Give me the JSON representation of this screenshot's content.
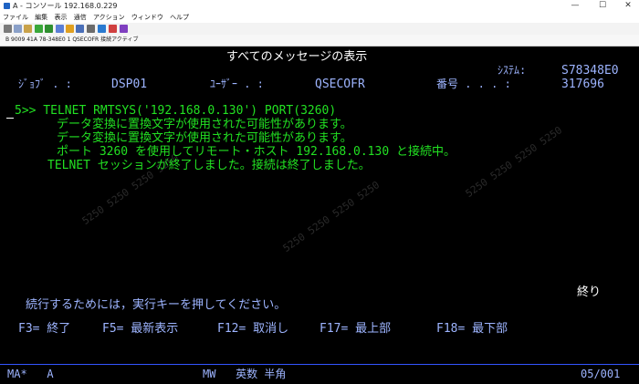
{
  "window": {
    "title": "A - コンソール 192.168.0.229",
    "minimize": "—",
    "maximize": "☐",
    "close": "✕"
  },
  "menu": [
    "ファイル",
    "編集",
    "表示",
    "通信",
    "アクション",
    "ウィンドウ",
    "ヘルプ"
  ],
  "session_bar": "B 9009 41A  78-348E0  1 QSECOFR    接続アクティブ",
  "screen": {
    "title": "すべてのメッセージの表示",
    "system_label": "ｼｽﾃﾑ:",
    "system_value": "S78348E0",
    "job_label": "ｼﾞｮﾌﾞ . :",
    "job_value": "DSP01",
    "user_label": "ﾕｰｻﾞｰ . :",
    "user_value": "QSECOFR",
    "number_label": "番号 . . . :",
    "number_value": "317696",
    "command": "5>> TELNET RMTSYS('192.168.0.130') PORT(3260)",
    "messages": [
      "データ変換に置換文字が使用された可能性があります。",
      "データ変換に置換文字が使用された可能性があります。",
      "ポート 3260 を使用してリモート・ホスト 192.168.0.130 と接続中。"
    ],
    "session_end": "TELNET セッションが終了しました。接続は終了しました。",
    "more": "終り",
    "prompt": "続行するためには，実行キーを押してください。",
    "fkeys": [
      "F3= 終了",
      "F5= 最新表示",
      "F12= 取消し",
      "F17= 最上部",
      "F18= 最下部"
    ]
  },
  "oia": {
    "left": "MA*   A",
    "mode": "MW   英数 半角",
    "position": "05/001"
  },
  "colors": {
    "green": "#22e022",
    "blue": "#9db4ff",
    "white": "#ffffff"
  }
}
